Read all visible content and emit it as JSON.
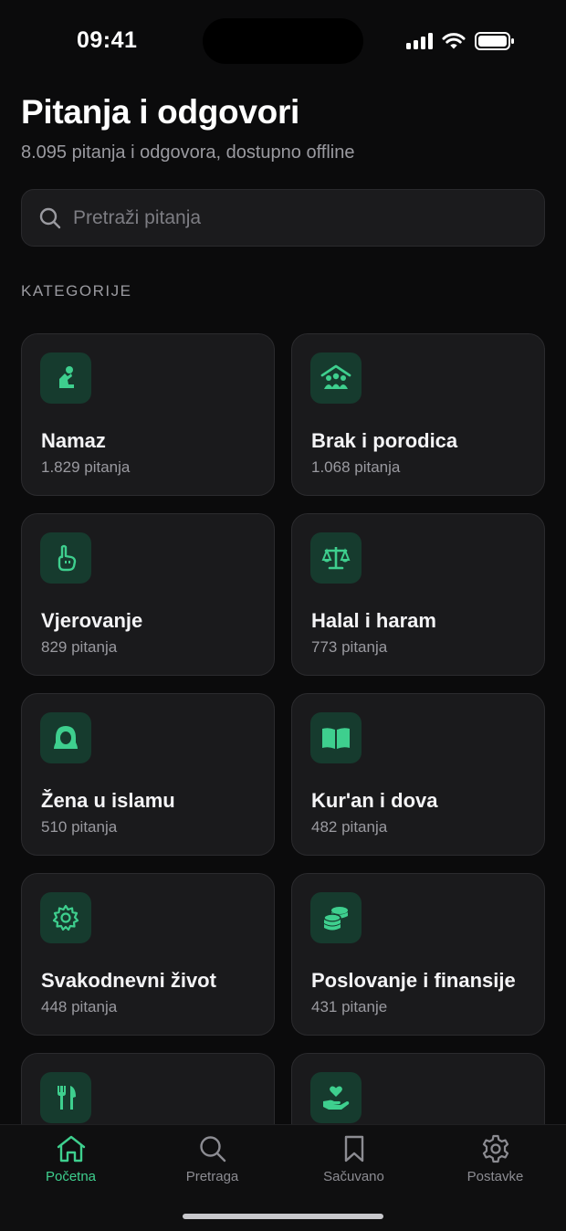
{
  "status_bar": {
    "time": "09:41"
  },
  "header": {
    "title": "Pitanja i odgovori",
    "subtitle": "8.095 pitanja i odgovora, dostupno offline"
  },
  "search": {
    "placeholder": "Pretraži pitanja",
    "value": ""
  },
  "categories_label": "KATEGORIJE",
  "categories": [
    {
      "name": "Namaz",
      "count": "1.829 pitanja",
      "icon": "prayer-icon"
    },
    {
      "name": "Brak i porodica",
      "count": "1.068 pitanja",
      "icon": "family-icon"
    },
    {
      "name": "Vjerovanje",
      "count": "829 pitanja",
      "icon": "raised-finger-icon"
    },
    {
      "name": "Halal i haram",
      "count": "773 pitanja",
      "icon": "scales-icon"
    },
    {
      "name": "Žena u islamu",
      "count": "510 pitanja",
      "icon": "hijab-icon"
    },
    {
      "name": "Kur'an i dova",
      "count": "482 pitanja",
      "icon": "book-icon"
    },
    {
      "name": "Svakodnevni život",
      "count": "448 pitanja",
      "icon": "gear-icon"
    },
    {
      "name": "Poslovanje i finansije",
      "count": "431 pitanje",
      "icon": "coins-icon"
    },
    {
      "name": "",
      "count": "",
      "icon": "utensils-icon"
    },
    {
      "name": "",
      "count": "",
      "icon": "charity-hand-icon"
    }
  ],
  "tabs": [
    {
      "label": "Početna",
      "icon": "home-icon",
      "active": true
    },
    {
      "label": "Pretraga",
      "icon": "search-icon",
      "active": false
    },
    {
      "label": "Sačuvano",
      "icon": "bookmark-icon",
      "active": false
    },
    {
      "label": "Postavke",
      "icon": "settings-icon",
      "active": false
    }
  ],
  "colors": {
    "background": "#0b0b0c",
    "card": "#1a1a1c",
    "accent": "#3ecf8e",
    "icon_bg": "#163b2e",
    "muted_text": "#9a9aa0"
  }
}
